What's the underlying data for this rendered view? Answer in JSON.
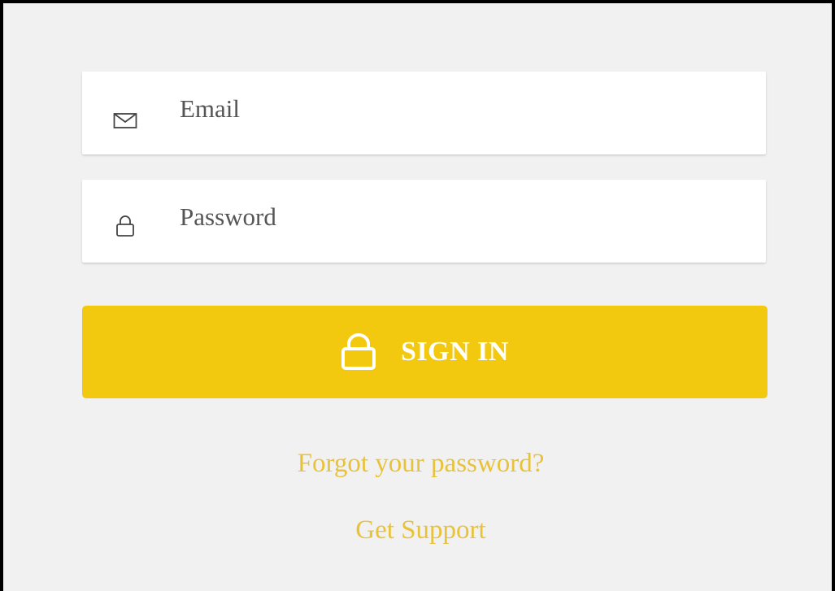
{
  "colors": {
    "background": "#f1f1f1",
    "field_background": "#ffffff",
    "accent": "#f2c90f",
    "link": "#e8c238",
    "button_text": "#ffffff"
  },
  "form": {
    "email": {
      "placeholder": "Email",
      "value": "",
      "icon": "envelope-icon"
    },
    "password": {
      "placeholder": "Password",
      "value": "",
      "icon": "lock-icon"
    },
    "submit": {
      "label": "SIGN IN",
      "icon": "lock-icon"
    }
  },
  "links": {
    "forgot_password": "Forgot your password?",
    "support": "Get Support"
  }
}
